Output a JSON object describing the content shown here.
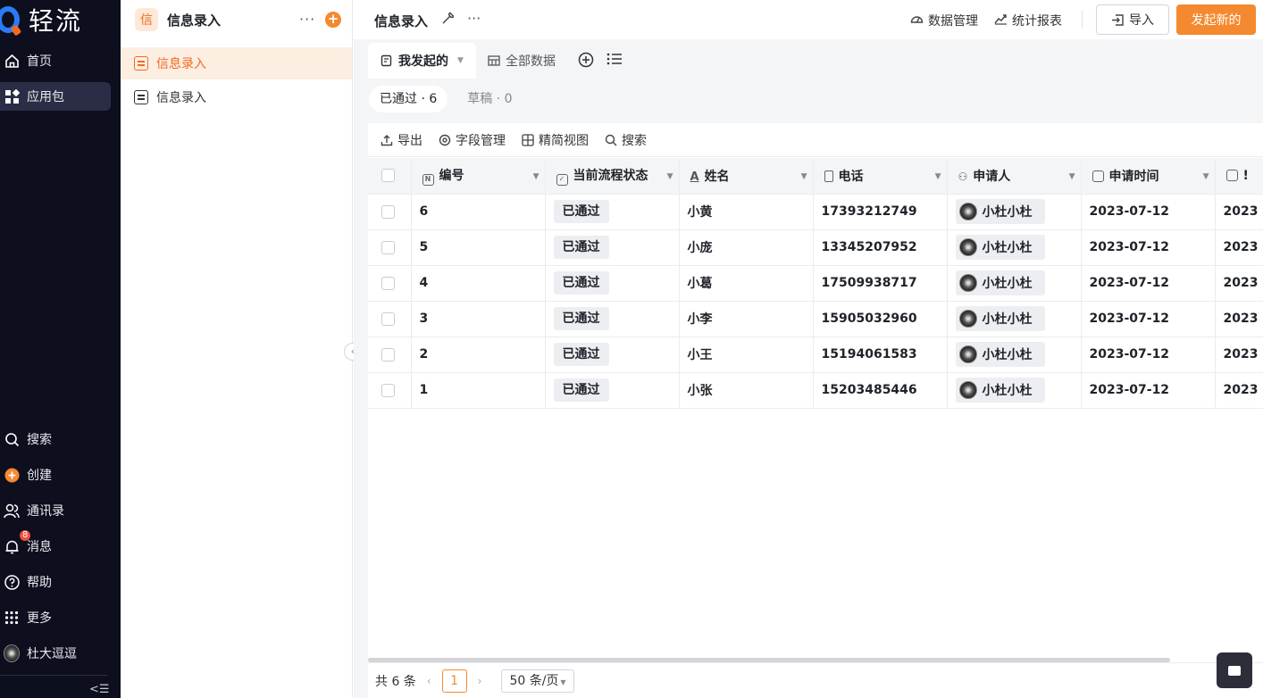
{
  "nav": {
    "logo_text": "轻流",
    "items": [
      {
        "label": "首页",
        "icon": "home-icon"
      },
      {
        "label": "应用包",
        "icon": "apps-icon"
      }
    ],
    "bottom_items": [
      {
        "label": "搜索",
        "icon": "search-icon"
      },
      {
        "label": "创建",
        "icon": "plus-circle-icon"
      },
      {
        "label": "通讯录",
        "icon": "contacts-icon"
      },
      {
        "label": "消息",
        "icon": "bell-icon",
        "badge": "8"
      },
      {
        "label": "帮助",
        "icon": "help-icon"
      },
      {
        "label": "更多",
        "icon": "grid-icon"
      },
      {
        "label": "杜大逗逗",
        "icon": "avatar"
      }
    ]
  },
  "sidebar": {
    "app_icon_char": "信",
    "title": "信息录入",
    "items": [
      {
        "label": "信息录入",
        "active": true
      },
      {
        "label": "信息录入",
        "active": false
      }
    ]
  },
  "topbar": {
    "title": "信息录入",
    "data_manage": "数据管理",
    "report": "统计报表",
    "import": "导入",
    "start_new": "发起新的"
  },
  "view_tabs": [
    {
      "label": "我发起的",
      "active": true
    },
    {
      "label": "全部数据",
      "active": false
    }
  ],
  "filters": [
    {
      "label": "已通过 · 6",
      "active": true
    },
    {
      "label": "草稿 · 0",
      "active": false
    }
  ],
  "toolbar": {
    "export": "导出",
    "fields": "字段管理",
    "compact_view": "精简视图",
    "search": "搜索"
  },
  "table": {
    "columns": [
      "编号",
      "当前流程状态",
      "姓名",
      "电话",
      "申请人",
      "申请时间",
      "!"
    ],
    "rows": [
      {
        "id": "6",
        "status": "已通过",
        "name": "小黄",
        "phone": "17393212749",
        "applicant": "小杜小杜",
        "time": "2023-07-12",
        "extra": "2023"
      },
      {
        "id": "5",
        "status": "已通过",
        "name": "小庞",
        "phone": "13345207952",
        "applicant": "小杜小杜",
        "time": "2023-07-12",
        "extra": "2023"
      },
      {
        "id": "4",
        "status": "已通过",
        "name": "小葛",
        "phone": "17509938717",
        "applicant": "小杜小杜",
        "time": "2023-07-12",
        "extra": "2023"
      },
      {
        "id": "3",
        "status": "已通过",
        "name": "小李",
        "phone": "15905032960",
        "applicant": "小杜小杜",
        "time": "2023-07-12",
        "extra": "2023"
      },
      {
        "id": "2",
        "status": "已通过",
        "name": "小王",
        "phone": "15194061583",
        "applicant": "小杜小杜",
        "time": "2023-07-12",
        "extra": "2023"
      },
      {
        "id": "1",
        "status": "已通过",
        "name": "小张",
        "phone": "15203485446",
        "applicant": "小杜小杜",
        "time": "2023-07-12",
        "extra": "2023"
      }
    ]
  },
  "pager": {
    "total": "共 6 条",
    "page": "1",
    "page_size": "50 条/页"
  },
  "colors": {
    "accent": "#f5892f",
    "nav_bg": "#0d0f1f",
    "active_item_bg": "#fdeee2"
  }
}
